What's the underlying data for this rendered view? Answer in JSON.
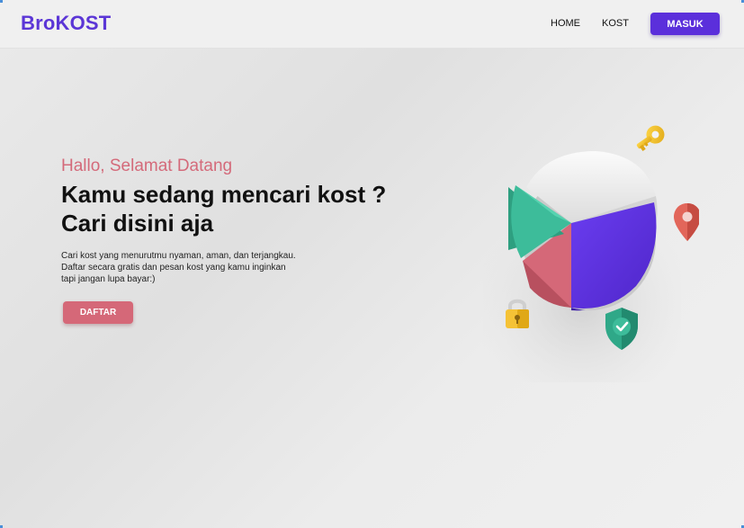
{
  "brand": {
    "name": "BroKOST",
    "color": "#5b36d6"
  },
  "nav": {
    "links": [
      {
        "label": "HOME"
      },
      {
        "label": "KOST"
      }
    ],
    "login_label": "MASUK"
  },
  "hero": {
    "greeting": "Hallo, Selamat Datang",
    "headline_line1": "Kamu sedang mencari kost ?",
    "headline_line2": "Cari disini aja",
    "description_lines": [
      "Cari kost yang menurutmu nyaman, aman, dan terjangkau.",
      "Daftar secara gratis dan pesan kost yang kamu inginkan",
      "tapi jangan lupa bayar:)"
    ],
    "register_label": "DAFTAR"
  },
  "illustration": {
    "icons": [
      "pie-chart-icon",
      "key-icon",
      "location-pin-icon",
      "padlock-icon",
      "shield-check-icon"
    ]
  },
  "colors": {
    "accent_purple": "#5b2fdb",
    "accent_pink": "#d56878",
    "pie_green": "#3dbc9a",
    "pie_white": "#f2f2f2"
  }
}
